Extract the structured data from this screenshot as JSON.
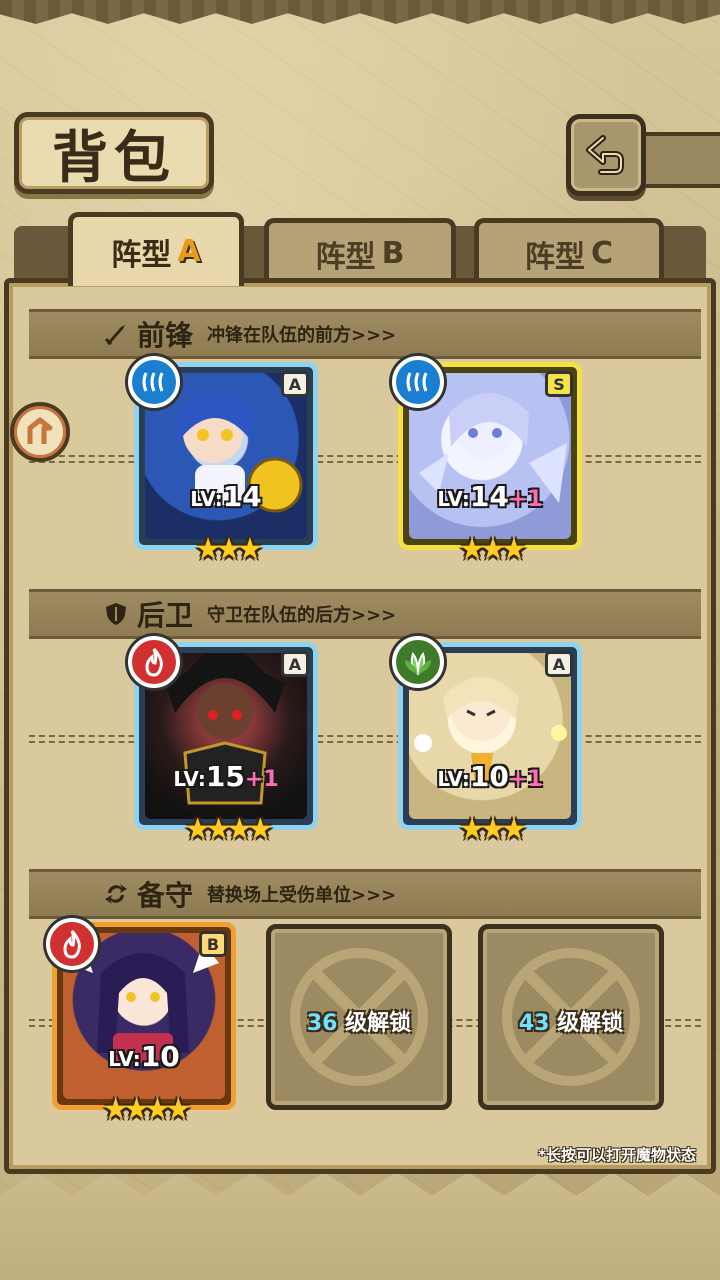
{
  "title": "背包",
  "tabs": [
    {
      "label": "阵型",
      "suffix": "A",
      "active": true
    },
    {
      "label": "阵型",
      "suffix": "B",
      "active": false
    },
    {
      "label": "阵型",
      "suffix": "C",
      "active": false
    }
  ],
  "sections": {
    "front": {
      "name": "前锋",
      "desc": "冲锋在队伍的前方>>>",
      "icon": "sword-icon"
    },
    "back": {
      "name": "后卫",
      "desc": "守卫在队伍的后方>>>",
      "icon": "shield-icon"
    },
    "reserve": {
      "name": "备守",
      "desc": "替换场上受伤单位>>>",
      "icon": "swap-icon"
    }
  },
  "cards": {
    "front_1": {
      "rank": "A",
      "element": "water",
      "lv_label": "LV:",
      "level": "14",
      "plus": "",
      "stars": "★★★"
    },
    "front_2": {
      "rank": "S",
      "element": "water",
      "lv_label": "LV:",
      "level": "14",
      "plus": "+1",
      "stars": "★★★"
    },
    "back_1": {
      "rank": "A",
      "element": "fire",
      "lv_label": "LV:",
      "level": "15",
      "plus": "+1",
      "stars": "★★★★"
    },
    "back_2": {
      "rank": "A",
      "element": "wood",
      "lv_label": "LV:",
      "level": "10",
      "plus": "+1",
      "stars": "★★★"
    },
    "reserve_1": {
      "rank": "B",
      "element": "fire",
      "lv_label": "LV:",
      "level": "10",
      "plus": "",
      "stars": "★★★★"
    }
  },
  "locked_slots": [
    {
      "level": "36",
      "text": "级解锁"
    },
    {
      "level": "43",
      "text": "级解锁"
    }
  ],
  "hint": "*长按可以打开魔物状态",
  "colors": {
    "tab_active_suffix": "#e89a1c",
    "plus_level": "#ff6bb5",
    "unlock_level": "#6fe0ff",
    "water": "#1a7fd0",
    "fire": "#d03030",
    "wood": "#3f7a2a"
  }
}
